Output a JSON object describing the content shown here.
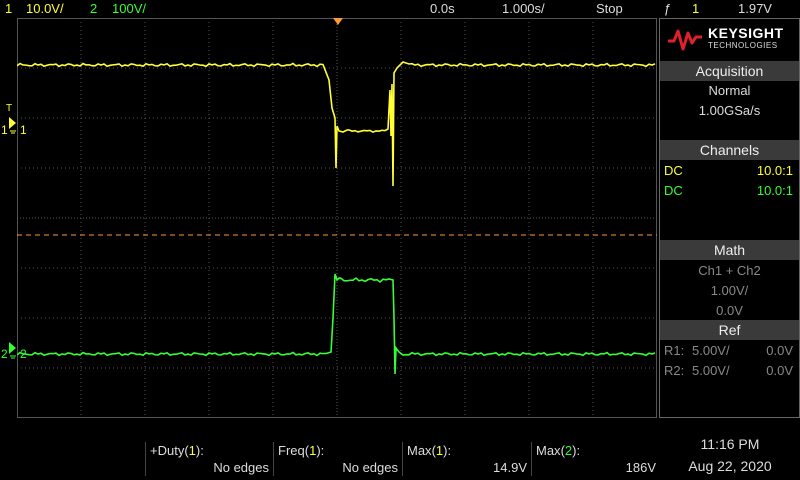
{
  "top": {
    "ch1_num": "1",
    "ch1_scale": "10.0V/",
    "ch2_num": "2",
    "ch2_scale": "100V/",
    "time_offset": "0.0s",
    "timebase": "1.000s/",
    "state": "Stop",
    "trig_icon": "ƒ",
    "trig_src": "1",
    "trig_level": "1.97V"
  },
  "markers": {
    "trig_T": "T",
    "ch1_label": "1",
    "ch1_marker": "1",
    "ch2_label": "2",
    "ch2_marker": "2"
  },
  "panel": {
    "brand": "KEYSIGHT",
    "brand_sub": "TECHNOLOGIES",
    "acq_title": "Acquisition",
    "acq_mode": "Normal",
    "acq_rate": "1.00GSa/s",
    "channels_title": "Channels",
    "ch1_coupling": "DC",
    "ch1_probe": "10.0:1",
    "ch2_coupling": "DC",
    "ch2_probe": "10.0:1",
    "math_title": "Math",
    "math_func": "Ch1 + Ch2",
    "math_scale": "1.00V/",
    "math_offset": "0.0V",
    "ref_title": "Ref",
    "r1_label": "R1:",
    "r1_scale": "5.00V/",
    "r1_offset": "0.0V",
    "r2_label": "R2:",
    "r2_scale": "5.00V/",
    "r2_offset": "0.0V"
  },
  "measurements": [
    {
      "name": "+Duty",
      "ch": "1",
      "value": "No edges"
    },
    {
      "name": "Freq",
      "ch": "1",
      "value": "No edges"
    },
    {
      "name": "Max",
      "ch": "1",
      "value": "14.9V"
    },
    {
      "name": "Max",
      "ch": "2",
      "value": "186V"
    }
  ],
  "clock": {
    "time": "11:16 PM",
    "date": "Aug 22, 2020"
  },
  "colors": {
    "ch1": "#ffff33",
    "ch2": "#33ff33",
    "trigger": "#ff9933",
    "grid": "#555555"
  }
}
